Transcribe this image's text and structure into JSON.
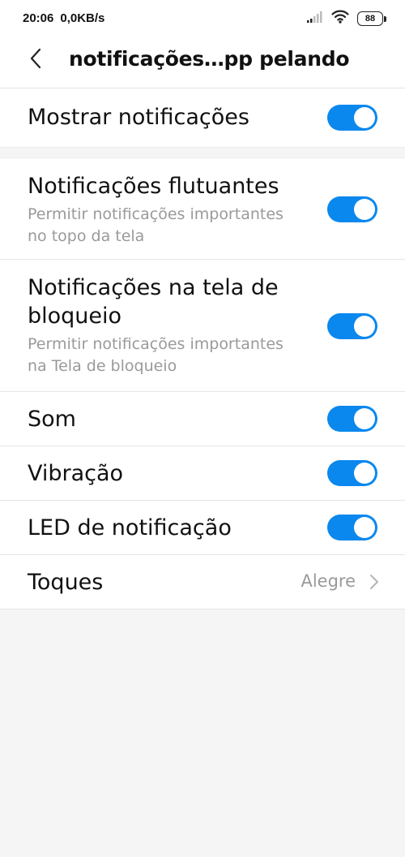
{
  "status_bar": {
    "time": "20:06",
    "network_speed": "0,0KB/s",
    "signal_icon": "signal-icon",
    "wifi_icon": "wifi-icon",
    "battery_level": "88"
  },
  "header": {
    "back_icon": "chevron-left-icon",
    "title": "notificações…pp pelando"
  },
  "settings": {
    "show_notifications": {
      "title": "Mostrar notificações",
      "enabled": true
    },
    "floating": {
      "title": "Notificações flutuantes",
      "subtitle_line1": "Permitir notificações importantes",
      "subtitle_line2": "no topo da tela",
      "enabled": true
    },
    "lockscreen": {
      "title_line1": "Notificações na tela de",
      "title_line2": "bloqueio",
      "subtitle_line1": "Permitir notificações importantes",
      "subtitle_line2": "na Tela de bloqueio",
      "enabled": true
    },
    "sound": {
      "title": "Som",
      "enabled": true
    },
    "vibration": {
      "title": "Vibração",
      "enabled": true
    },
    "led": {
      "title": "LED de notificação",
      "enabled": true
    },
    "ringtone": {
      "title": "Toques",
      "value": "Alegre",
      "icon": "chevron-right-icon"
    }
  },
  "colors": {
    "accent": "#0a88ee",
    "background": "#f5f5f5",
    "surface": "#ffffff",
    "secondary_text": "#9a9a9a"
  }
}
